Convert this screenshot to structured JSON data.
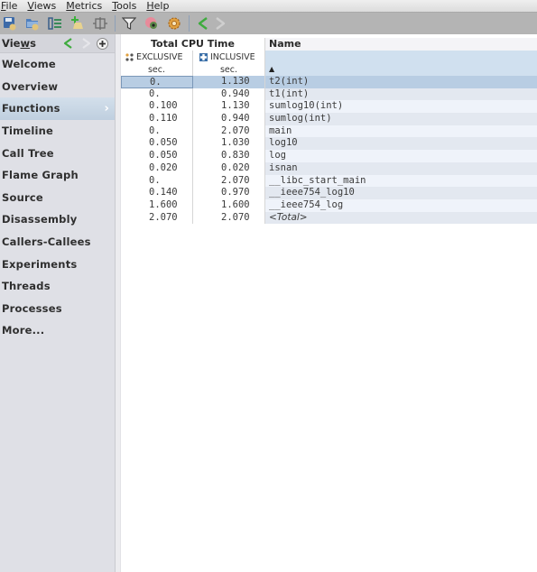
{
  "menubar": {
    "items": [
      {
        "label": "File",
        "mnemonic": "F"
      },
      {
        "label": "Views",
        "mnemonic": "V"
      },
      {
        "label": "Metrics",
        "mnemonic": "M"
      },
      {
        "label": "Tools",
        "mnemonic": "T"
      },
      {
        "label": "Help",
        "mnemonic": "H"
      }
    ]
  },
  "toolbar": {
    "buttons": [
      {
        "name": "save-experiment",
        "icon": "save-icon"
      },
      {
        "name": "open-experiment",
        "icon": "folder-icon"
      },
      {
        "name": "compare-experiments",
        "icon": "compare-icon"
      },
      {
        "name": "add-experiment",
        "icon": "add-experiment-icon"
      },
      {
        "name": "split-view",
        "icon": "split-icon"
      },
      {
        "name": "filter",
        "icon": "filter-icon"
      },
      {
        "name": "view-mode",
        "icon": "eye-icon"
      },
      {
        "name": "settings",
        "icon": "gear-icon"
      },
      {
        "name": "back",
        "icon": "back-arrow-icon"
      },
      {
        "name": "forward",
        "icon": "forward-arrow-icon"
      }
    ]
  },
  "sidebar": {
    "title": "Views",
    "items": [
      {
        "label": "Welcome",
        "selected": false
      },
      {
        "label": "Overview",
        "selected": false
      },
      {
        "label": "Functions",
        "selected": true
      },
      {
        "label": "Timeline",
        "selected": false
      },
      {
        "label": "Call Tree",
        "selected": false
      },
      {
        "label": "Flame Graph",
        "selected": false
      },
      {
        "label": "Source",
        "selected": false
      },
      {
        "label": "Disassembly",
        "selected": false
      },
      {
        "label": "Callers-Callees",
        "selected": false
      },
      {
        "label": "Experiments",
        "selected": false
      },
      {
        "label": "Threads",
        "selected": false
      },
      {
        "label": "Processes",
        "selected": false
      },
      {
        "label": "More...",
        "selected": false
      }
    ]
  },
  "table": {
    "group_header": "Total CPU Time",
    "name_header": "Name",
    "sort_indicator": "▲",
    "columns": [
      {
        "label": "EXCLUSIVE",
        "unit": "sec."
      },
      {
        "label": "INCLUSIVE",
        "unit": "sec."
      }
    ],
    "rows": [
      {
        "exclusive": "0.",
        "inclusive": "1.130",
        "name": "t2(int)",
        "selected": true
      },
      {
        "exclusive": "0.",
        "inclusive": "0.940",
        "name": "t1(int)"
      },
      {
        "exclusive": "0.100",
        "inclusive": "1.130",
        "name": "sumlog10(int)"
      },
      {
        "exclusive": "0.110",
        "inclusive": "0.940",
        "name": "sumlog(int)"
      },
      {
        "exclusive": "0.",
        "inclusive": "2.070",
        "name": "main"
      },
      {
        "exclusive": "0.050",
        "inclusive": "1.030",
        "name": "log10"
      },
      {
        "exclusive": "0.050",
        "inclusive": "0.830",
        "name": "log"
      },
      {
        "exclusive": "0.020",
        "inclusive": "0.020",
        "name": "isnan"
      },
      {
        "exclusive": "0.",
        "inclusive": "2.070",
        "name": "__libc_start_main"
      },
      {
        "exclusive": "0.140",
        "inclusive": "0.970",
        "name": "__ieee754_log10"
      },
      {
        "exclusive": "1.600",
        "inclusive": "1.600",
        "name": "__ieee754_log"
      },
      {
        "exclusive": "2.070",
        "inclusive": "2.070",
        "name": "<Total>",
        "italic": true
      }
    ]
  }
}
